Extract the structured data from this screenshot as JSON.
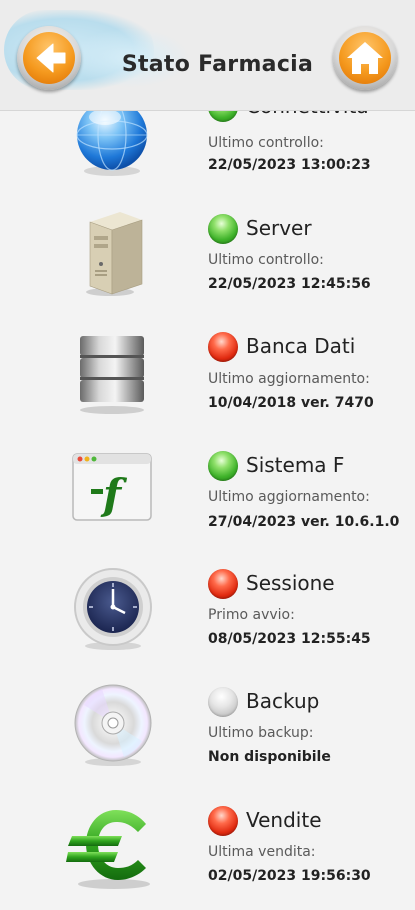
{
  "header": {
    "title": "Stato Farmacia",
    "back_icon": "arrow-left-icon",
    "home_icon": "home-icon"
  },
  "items": [
    {
      "name": "Connettività",
      "status": "green",
      "label": "Ultimo controllo:",
      "value": "22/05/2023 13:00:23",
      "icon": "globe-icon"
    },
    {
      "name": "Server",
      "status": "green",
      "label": "Ultimo controllo:",
      "value": "22/05/2023 12:45:56",
      "icon": "server-icon"
    },
    {
      "name": "Banca Dati",
      "status": "red",
      "label": "Ultimo aggiornamento:",
      "value": "10/04/2018 ver. 7470",
      "icon": "database-icon"
    },
    {
      "name": "Sistema F",
      "status": "green",
      "label": "Ultimo aggiornamento:",
      "value": "27/04/2023 ver. 10.6.1.0",
      "icon": "app-window-icon"
    },
    {
      "name": "Sessione",
      "status": "red",
      "label": "Primo avvio:",
      "value": "08/05/2023 12:55:45",
      "icon": "clock-icon"
    },
    {
      "name": "Backup",
      "status": "grey",
      "label": "Ultimo backup:",
      "value": "Non disponibile",
      "icon": "cd-icon"
    },
    {
      "name": "Vendite",
      "status": "red",
      "label": "Ultima vendita:",
      "value": "02/05/2023 19:56:30",
      "icon": "euro-icon"
    }
  ],
  "colors": {
    "header_bg": "#ececec",
    "accent_orange": "#f59a1f",
    "status_green": "#3fb22a",
    "status_red": "#e02a10",
    "status_grey": "#c4c4c4"
  }
}
